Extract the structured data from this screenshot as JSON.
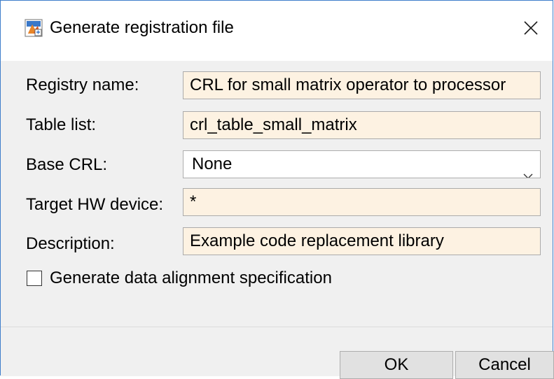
{
  "window": {
    "title": "Generate registration file",
    "app_icon": "matlab-icon",
    "close_icon": "close-icon"
  },
  "form": {
    "registry_name": {
      "label": "Registry name:",
      "value": "CRL for small matrix operator to processor"
    },
    "table_list": {
      "label": "Table list:",
      "value": "crl_table_small_matrix"
    },
    "base_crl": {
      "label": "Base CRL:",
      "value": "None"
    },
    "target_hw": {
      "label": "Target HW device:",
      "value": "*"
    },
    "description": {
      "label": "Description:",
      "value": "Example code replacement library"
    },
    "data_alignment": {
      "label": "Generate data alignment specification",
      "checked": false
    }
  },
  "buttons": {
    "ok": "OK",
    "cancel": "Cancel"
  },
  "colors": {
    "editable_field_bg": "#fdf2e2",
    "window_border": "#3f7ecb",
    "dialog_bg": "#f0f0f0"
  }
}
